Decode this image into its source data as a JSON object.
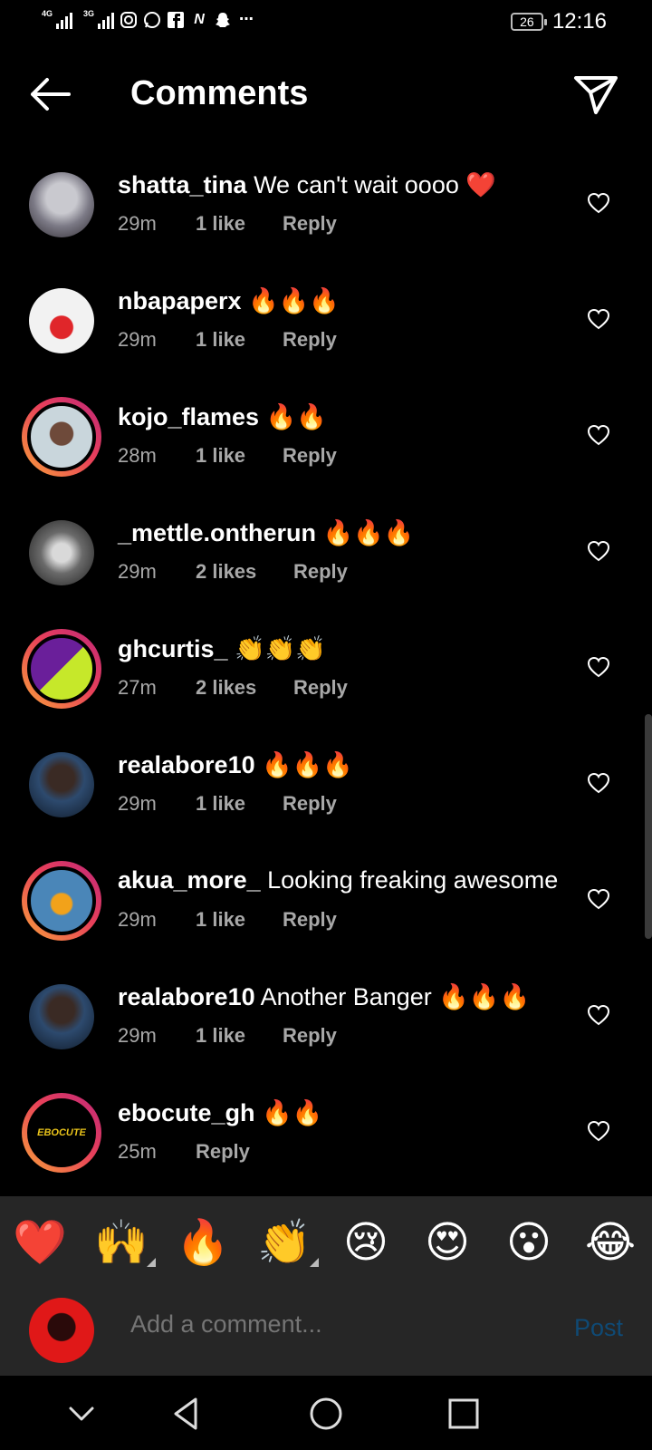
{
  "status_bar": {
    "net1": "4G",
    "net2": "3G",
    "app_icons": [
      "instagram-icon",
      "whatsapp-icon",
      "facebook-icon",
      "news-icon",
      "snapchat-icon",
      "more-icon"
    ],
    "battery": "26",
    "time": "12:16"
  },
  "header": {
    "title": "Comments"
  },
  "comments": [
    {
      "user": "shatta_tina",
      "text": "We can't wait oooo ❤️",
      "time": "29m",
      "likes": "1 like",
      "reply": "Reply"
    },
    {
      "user": "nbapaperx",
      "text": "🔥🔥🔥",
      "time": "29m",
      "likes": "1 like",
      "reply": "Reply"
    },
    {
      "user": "kojo_flames",
      "text": "🔥🔥",
      "time": "28m",
      "likes": "1 like",
      "reply": "Reply"
    },
    {
      "user": "_mettle.ontherun",
      "text": "🔥🔥🔥",
      "time": "29m",
      "likes": "2 likes",
      "reply": "Reply"
    },
    {
      "user": "ghcurtis_",
      "text": "👏👏👏",
      "time": "27m",
      "likes": "2 likes",
      "reply": "Reply"
    },
    {
      "user": "realabore10",
      "text": "🔥🔥🔥",
      "time": "29m",
      "likes": "1 like",
      "reply": "Reply"
    },
    {
      "user": "akua_more_",
      "text": "Looking freaking awesome",
      "time": "29m",
      "likes": "1 like",
      "reply": "Reply"
    },
    {
      "user": "realabore10",
      "text": "Another Banger 🔥🔥🔥",
      "time": "29m",
      "likes": "1 like",
      "reply": "Reply"
    },
    {
      "user": "ebocute_gh",
      "text": "🔥🔥",
      "time": "25m",
      "likes": "",
      "reply": "Reply",
      "avatar_text": "EBOCUTE"
    }
  ],
  "emoji_bar": [
    "❤️",
    "🙌",
    "🔥",
    "👏",
    "😢",
    "😍",
    "😮",
    "😂"
  ],
  "composer": {
    "placeholder": "Add a comment...",
    "post_label": "Post"
  },
  "colors": {
    "background": "#000000",
    "panel": "#262626",
    "meta_text": "#a8a8a8",
    "post_disabled": "#0f4a75",
    "story_ring_start": "#f9a13a",
    "story_ring_end": "#c0277a"
  }
}
